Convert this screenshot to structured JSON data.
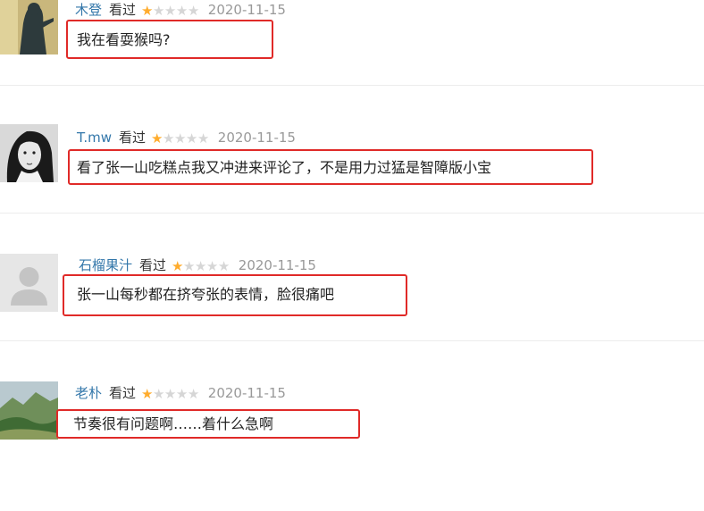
{
  "reviews": [
    {
      "username": "木登",
      "action": "看过",
      "rating": 1,
      "max_rating": 5,
      "date": "2020-11-15",
      "comment": "我在看耍猴吗?",
      "avatar": "silhouette-figure-avatar"
    },
    {
      "username": "T.mw",
      "action": "看过",
      "rating": 1,
      "max_rating": 5,
      "date": "2020-11-15",
      "comment": "看了张一山吃糕点我又冲进来评论了，不是用力过猛是智障版小宝",
      "avatar": "bw-portrait-avatar"
    },
    {
      "username": "石榴果汁",
      "action": "看过",
      "rating": 1,
      "max_rating": 5,
      "date": "2020-11-15",
      "comment": "张一山每秒都在挤夸张的表情，脸很痛吧",
      "avatar": "default-user-avatar"
    },
    {
      "username": "老朴",
      "action": "看过",
      "rating": 1,
      "max_rating": 5,
      "date": "2020-11-15",
      "comment": "节奏很有问题啊……着什么急啊",
      "avatar": "landscape-avatar"
    }
  ],
  "colors": {
    "username": "#3377aa",
    "star_on": "#ffac2d",
    "star_off": "#d6d6d6",
    "highlight_border": "#e02a28",
    "date": "#999999"
  }
}
